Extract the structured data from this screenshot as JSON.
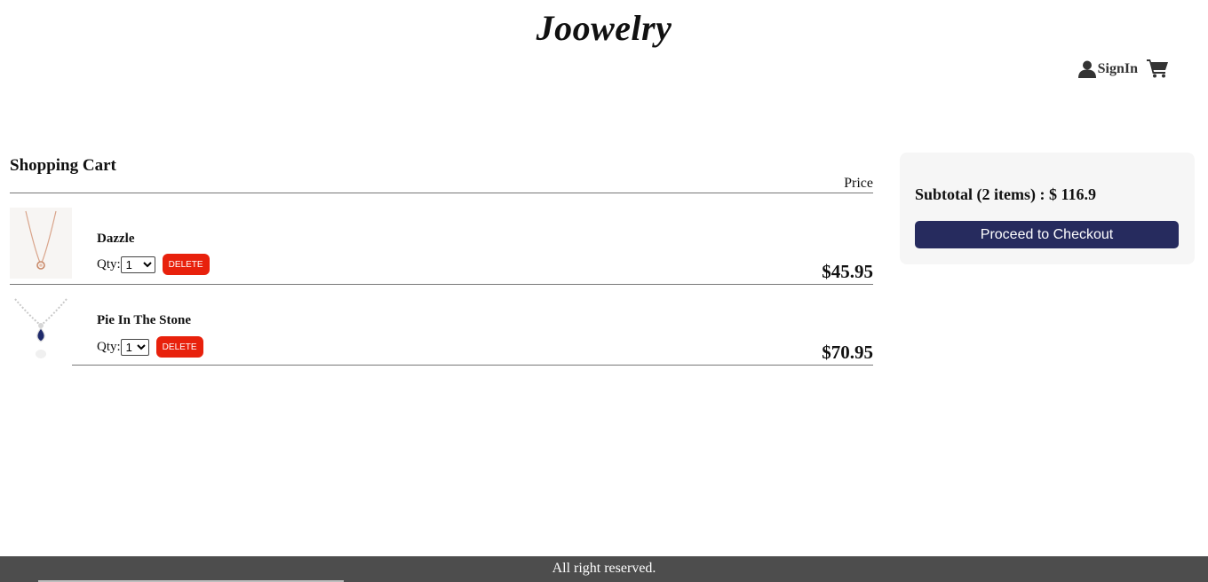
{
  "header": {
    "brand": "Joowelry",
    "signin_label": "SignIn",
    "signin_icon": "user-icon",
    "cart_icon": "shopping-cart-icon"
  },
  "cart": {
    "title": "Shopping Cart",
    "price_header": "Price",
    "qty_label": "Qty:",
    "delete_label": "DELETE",
    "items": [
      {
        "name": "Dazzle",
        "qty": "1",
        "price": "$45.95"
      },
      {
        "name": "Pie In The Stone",
        "qty": "1",
        "price": "$70.95"
      }
    ]
  },
  "summary": {
    "subtotal": "Subtotal (2 items) : $ 116.9",
    "checkout_label": "Proceed to Checkout"
  },
  "footer": {
    "text": "All right reserved."
  },
  "colors": {
    "checkout": "#262b5e",
    "delete": "#e8210c",
    "footer": "#4d4d4d",
    "summary_bg": "#f6f6f6"
  }
}
